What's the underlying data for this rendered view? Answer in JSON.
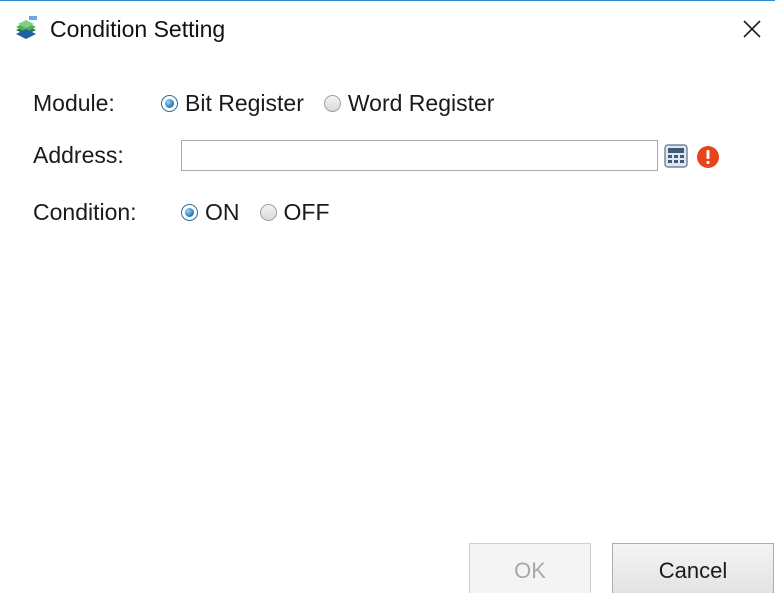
{
  "window": {
    "title": "Condition Setting",
    "icon": "app-stack-icon",
    "close_icon": "close-icon"
  },
  "module": {
    "label": "Module:",
    "options": [
      {
        "label": "Bit Register",
        "checked": true
      },
      {
        "label": "Word Register",
        "checked": false
      }
    ]
  },
  "address": {
    "label": "Address:",
    "value": "",
    "placeholder": "",
    "calc_icon": "calculator-icon",
    "error_icon": "error-exclamation-icon",
    "error_color": "#e8431a"
  },
  "condition": {
    "label": "Condition:",
    "options": [
      {
        "label": "ON",
        "checked": true
      },
      {
        "label": "OFF",
        "checked": false
      }
    ]
  },
  "buttons": {
    "ok_label": "OK",
    "ok_enabled": false,
    "cancel_label": "Cancel"
  },
  "colors": {
    "accent": "#2b8ad8",
    "radio_checked": "#1e73b8"
  }
}
